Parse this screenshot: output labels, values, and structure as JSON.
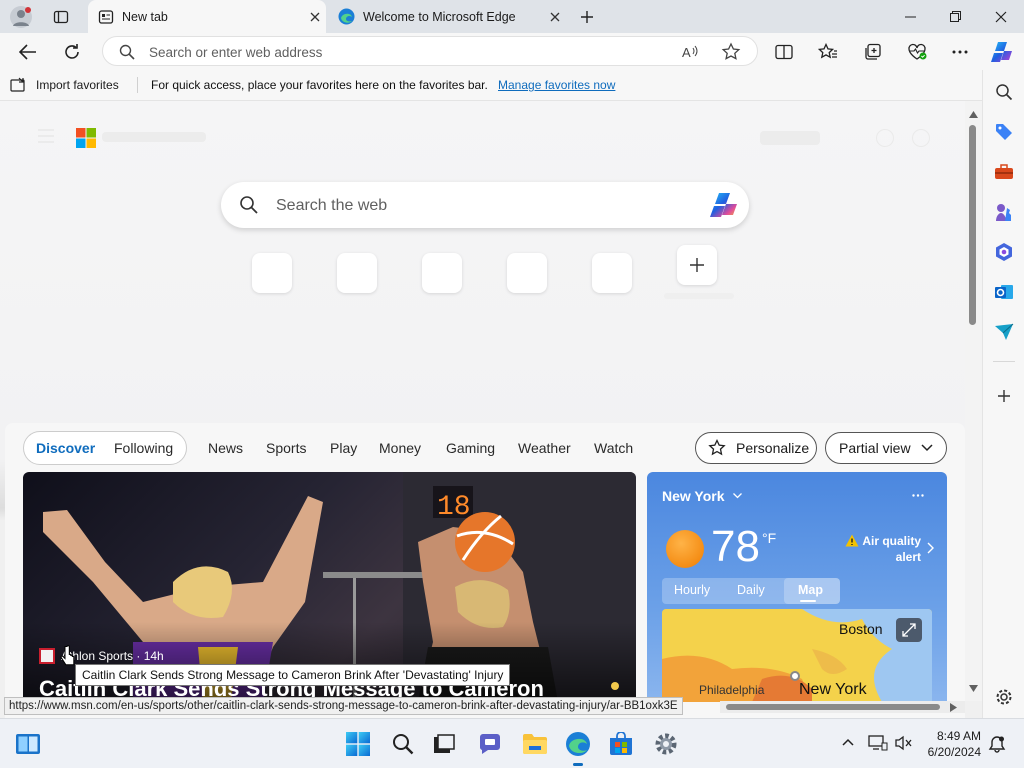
{
  "tabs": [
    {
      "label": "New tab",
      "active": true,
      "icon": "newtab-icon"
    },
    {
      "label": "Welcome to Microsoft Edge",
      "active": false,
      "icon": "edge-icon"
    }
  ],
  "address_bar": {
    "placeholder": "Search or enter web address"
  },
  "favorites_bar": {
    "import_label": "Import favorites",
    "message": "For quick access, place your favorites here on the favorites bar.",
    "manage_link": "Manage favorites now"
  },
  "newtab": {
    "search_placeholder": "Search the web"
  },
  "feed": {
    "pill_tabs": [
      "Discover",
      "Following"
    ],
    "nav": [
      "News",
      "Sports",
      "Play",
      "Money",
      "Gaming",
      "Weather",
      "Watch"
    ],
    "personalize": "Personalize",
    "view_mode": "Partial view",
    "hero": {
      "source": "Athlon Sports · 14h",
      "headline": "Caitlin Clark Sends Strong Message to Cameron"
    },
    "weather": {
      "location": "New York",
      "temp": "78",
      "unit": "°F",
      "alert_line1": "Air quality",
      "alert_line2": "alert",
      "tabs": [
        "Hourly",
        "Daily",
        "Map"
      ],
      "active_tab": "Map",
      "map_labels": [
        "Boston",
        "Philadelphia",
        "New York"
      ]
    }
  },
  "tooltip": "Caitlin Clark Sends Strong Message to Cameron Brink After 'Devastating' Injury",
  "status_url": "https://www.msn.com/en-us/sports/other/caitlin-clark-sends-strong-message-to-cameron-brink-after-devastating-injury/ar-BB1oxk3E",
  "taskbar": {
    "time": "8:49 AM",
    "date": "6/20/2024"
  },
  "colors": {
    "accent": "#0f6cbd",
    "edge_blue": "#1b7fd6",
    "weather_bg": "#5a93e4"
  }
}
